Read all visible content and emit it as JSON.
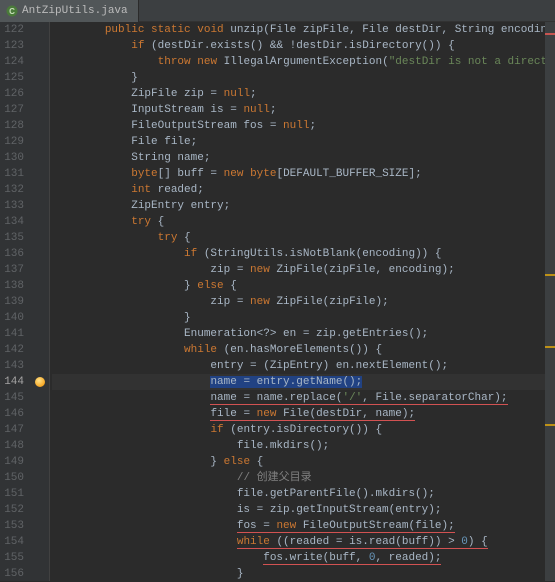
{
  "tab": {
    "filename": "AntZipUtils.java"
  },
  "line_start": 122,
  "highlighted_line": 144,
  "code_lines": [
    [
      [
        "        ",
        ""
      ],
      [
        "public",
        "kw"
      ],
      [
        " ",
        ""
      ],
      [
        "static",
        "kw"
      ],
      [
        " ",
        ""
      ],
      [
        "void",
        "kw"
      ],
      [
        " unzip(File zipFile, File destDir, String encoding) {",
        ""
      ]
    ],
    [
      [
        "            ",
        ""
      ],
      [
        "if",
        "kw"
      ],
      [
        " (destDir.exists() && !destDir.isDirectory()) {",
        ""
      ]
    ],
    [
      [
        "                ",
        ""
      ],
      [
        "throw",
        "kw"
      ],
      [
        " ",
        ""
      ],
      [
        "new",
        "kw"
      ],
      [
        " IllegalArgumentException(",
        ""
      ],
      [
        "\"destDir is not a directory!\"",
        "str"
      ],
      [
        ");",
        ""
      ]
    ],
    [
      [
        "            }",
        ""
      ]
    ],
    [
      [
        "            ZipFile zip = ",
        ""
      ],
      [
        "null",
        "kw"
      ],
      [
        ";",
        ""
      ]
    ],
    [
      [
        "            InputStream is = ",
        ""
      ],
      [
        "null",
        "kw"
      ],
      [
        ";",
        ""
      ]
    ],
    [
      [
        "            FileOutputStream fos = ",
        ""
      ],
      [
        "null",
        "kw"
      ],
      [
        ";",
        ""
      ]
    ],
    [
      [
        "            File file;",
        ""
      ]
    ],
    [
      [
        "            String name;",
        ""
      ]
    ],
    [
      [
        "            ",
        ""
      ],
      [
        "byte",
        "kw"
      ],
      [
        "[] buff = ",
        ""
      ],
      [
        "new",
        "kw"
      ],
      [
        " ",
        ""
      ],
      [
        "byte",
        "kw"
      ],
      [
        "[DEFAULT_BUFFER_SIZE];",
        ""
      ]
    ],
    [
      [
        "            ",
        ""
      ],
      [
        "int",
        "kw"
      ],
      [
        " readed;",
        ""
      ]
    ],
    [
      [
        "            ZipEntry entry;",
        ""
      ]
    ],
    [
      [
        "            ",
        ""
      ],
      [
        "try",
        "kw"
      ],
      [
        " {",
        ""
      ]
    ],
    [
      [
        "                ",
        ""
      ],
      [
        "try",
        "kw"
      ],
      [
        " {",
        ""
      ]
    ],
    [
      [
        "                    ",
        ""
      ],
      [
        "if",
        "kw"
      ],
      [
        " (StringUtils.isNotBlank(encoding)) {",
        ""
      ]
    ],
    [
      [
        "                        zip = ",
        ""
      ],
      [
        "new",
        "kw"
      ],
      [
        " ZipFile(zipFile, encoding);",
        ""
      ]
    ],
    [
      [
        "                    } ",
        ""
      ],
      [
        "else",
        "kw"
      ],
      [
        " {",
        ""
      ]
    ],
    [
      [
        "                        zip = ",
        ""
      ],
      [
        "new",
        "kw"
      ],
      [
        " ZipFile(zipFile);",
        ""
      ]
    ],
    [
      [
        "                    }",
        ""
      ]
    ],
    [
      [
        "                    Enumeration<?> en = zip.getEntries();",
        ""
      ]
    ],
    [
      [
        "                    ",
        ""
      ],
      [
        "while",
        "kw"
      ],
      [
        " (en.hasMoreElements()) {",
        ""
      ]
    ],
    [
      [
        "                        entry = (ZipEntry) en.nextElement();",
        ""
      ]
    ],
    [
      [
        "                        ",
        ""
      ],
      [
        "name = entry.getName();",
        "sel-bg"
      ]
    ],
    [
      [
        "                        ",
        ""
      ],
      [
        "name = name.replace(",
        "uline-red"
      ],
      [
        "'/'",
        "str uline-red"
      ],
      [
        ", File.separatorChar);",
        "uline-red"
      ]
    ],
    [
      [
        "                        ",
        ""
      ],
      [
        "file = ",
        "uline-red"
      ],
      [
        "new",
        "kw uline-red"
      ],
      [
        " File(destDir, name);",
        "uline-red"
      ]
    ],
    [
      [
        "                        ",
        ""
      ],
      [
        "if",
        "kw"
      ],
      [
        " (entry.isDirectory()) {",
        ""
      ]
    ],
    [
      [
        "                            file.mkdirs();",
        ""
      ]
    ],
    [
      [
        "                        } ",
        ""
      ],
      [
        "else",
        "kw"
      ],
      [
        " {",
        ""
      ]
    ],
    [
      [
        "                            ",
        ""
      ],
      [
        "// 创建父目录",
        "cmt"
      ]
    ],
    [
      [
        "                            file.getParentFile().mkdirs();",
        ""
      ]
    ],
    [
      [
        "                            is = zip.getInputStream(entry);",
        ""
      ]
    ],
    [
      [
        "                            ",
        ""
      ],
      [
        "fos = ",
        "uline-red"
      ],
      [
        "new",
        "kw uline-red"
      ],
      [
        " FileOutputStream(file);",
        "uline-red"
      ]
    ],
    [
      [
        "                            ",
        ""
      ],
      [
        "while",
        "kw uline-red"
      ],
      [
        " ((readed = is.read(buff)) > ",
        "uline-red"
      ],
      [
        "0",
        "num uline-red"
      ],
      [
        ") {",
        "uline-red"
      ]
    ],
    [
      [
        "                                ",
        ""
      ],
      [
        "fos.write(buff, ",
        "uline-red"
      ],
      [
        "0",
        "num uline-red"
      ],
      [
        ", readed);",
        "uline-red"
      ]
    ],
    [
      [
        "                            }",
        ""
      ]
    ]
  ],
  "scrollbar_markers": [
    {
      "type": "err",
      "top_pct": 2
    },
    {
      "type": "warn",
      "top_pct": 45
    },
    {
      "type": "warn",
      "top_pct": 58
    },
    {
      "type": "warn",
      "top_pct": 72
    }
  ]
}
